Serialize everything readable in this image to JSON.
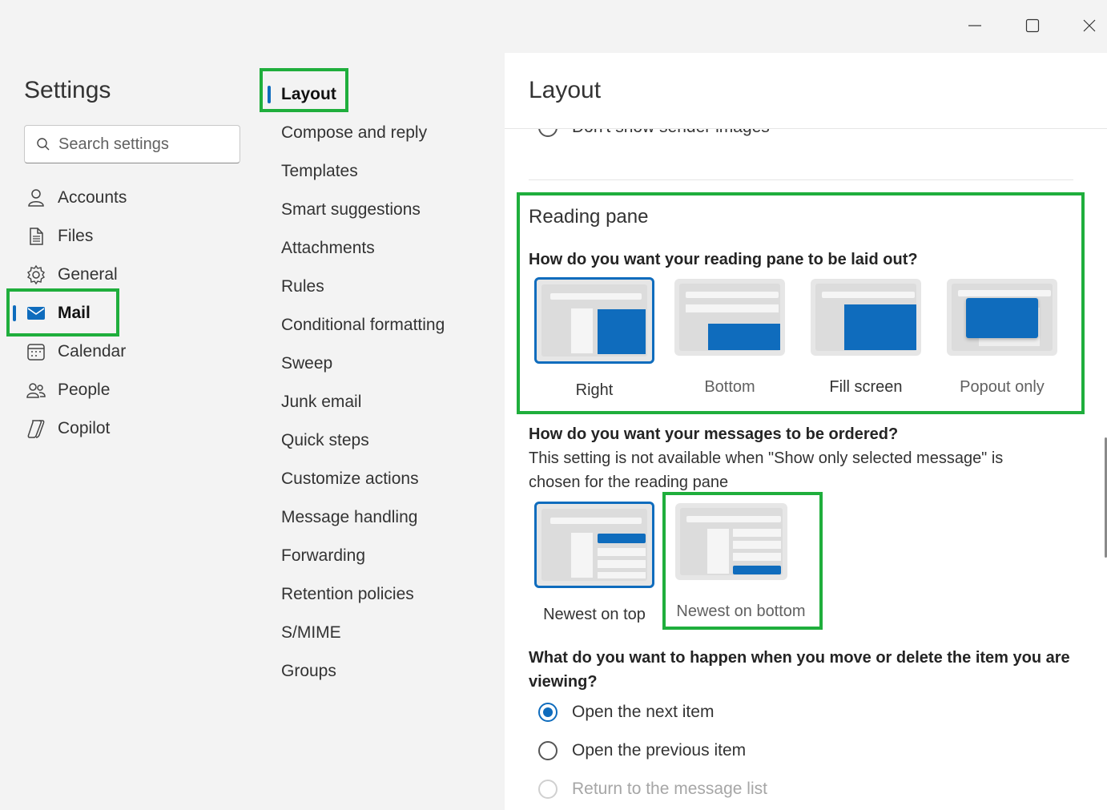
{
  "window": {
    "minimize_icon": "minimize-icon",
    "maximize_icon": "maximize-icon",
    "close_icon": "close-icon"
  },
  "left_nav": {
    "title": "Settings",
    "search_placeholder": "Search settings",
    "items": [
      {
        "label": "Accounts",
        "icon": "person-icon"
      },
      {
        "label": "Files",
        "icon": "file-icon"
      },
      {
        "label": "General",
        "icon": "gear-icon"
      },
      {
        "label": "Mail",
        "icon": "mail-icon",
        "active": true
      },
      {
        "label": "Calendar",
        "icon": "calendar-icon"
      },
      {
        "label": "People",
        "icon": "people-icon"
      },
      {
        "label": "Copilot",
        "icon": "copilot-icon"
      }
    ]
  },
  "mid_nav": {
    "items": [
      "Layout",
      "Compose and reply",
      "Templates",
      "Smart suggestions",
      "Attachments",
      "Rules",
      "Conditional formatting",
      "Sweep",
      "Junk email",
      "Quick steps",
      "Customize actions",
      "Message handling",
      "Forwarding",
      "Retention policies",
      "S/MIME",
      "Groups"
    ],
    "active_index": 0
  },
  "content": {
    "title": "Layout",
    "sender_images_option": "Don't show sender images",
    "reading_pane": {
      "title": "Reading pane",
      "question": "How do you want your reading pane to be laid out?",
      "options": [
        "Right",
        "Bottom",
        "Fill screen",
        "Popout only"
      ],
      "selected": "Right"
    },
    "ordering": {
      "question": "How do you want your messages to be ordered?",
      "note": "This setting is not available when \"Show only selected message\" is chosen for the reading pane",
      "options": [
        "Newest on top",
        "Newest on bottom"
      ],
      "selected": "Newest on top"
    },
    "move_delete": {
      "question": "What do you want to happen when you move or delete the item you are viewing?",
      "options": [
        "Open the next item",
        "Open the previous item",
        "Return to the message list"
      ],
      "selected": "Open the next item",
      "disabled": "Return to the message list"
    }
  },
  "colors": {
    "accent": "#0f6cbd",
    "highlight": "#1fae3c"
  }
}
